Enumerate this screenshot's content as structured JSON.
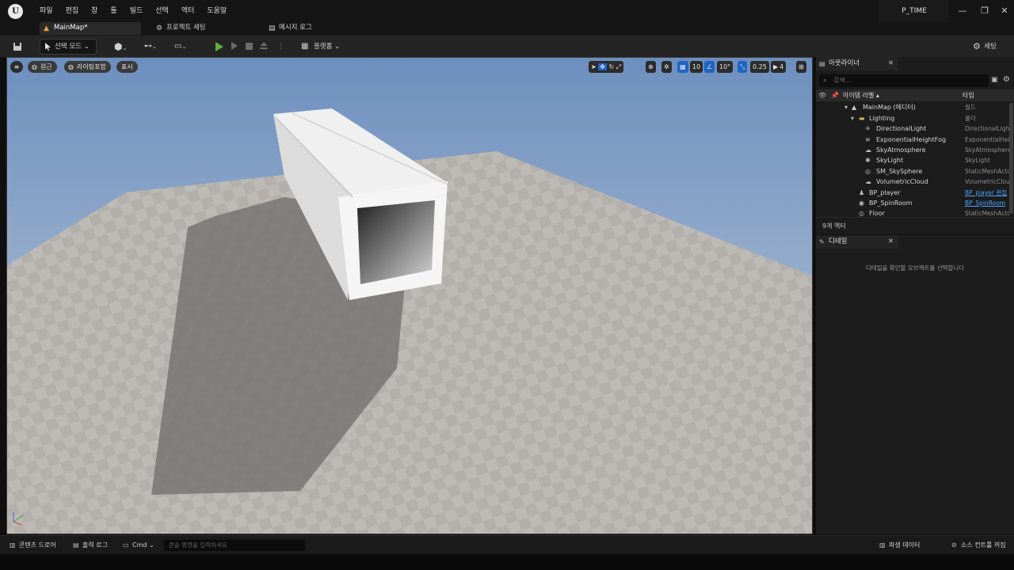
{
  "app": {
    "logo_text": "U",
    "project_name": "P_TIME",
    "window_controls": [
      "—",
      "❐",
      "✕"
    ]
  },
  "menu": [
    "파일",
    "편집",
    "창",
    "툴",
    "빌드",
    "선택",
    "액터",
    "도움말"
  ],
  "tabs": [
    {
      "label": "MainMap*",
      "icon": "level-icon"
    },
    {
      "label": "프로젝트 세팅",
      "icon": "settings-tab-icon"
    },
    {
      "label": "메시지 로그",
      "icon": "log-icon"
    }
  ],
  "toolbar": {
    "select_mode": "선택 모드",
    "platforms": "플랫폼",
    "settings": "세팅"
  },
  "viewport": {
    "perspective": "원근",
    "lit": "라이팅포함",
    "show": "표시",
    "grid_snap": "10",
    "rotation_snap": "10°",
    "scale_snap": "0.25",
    "camera_speed": "4",
    "colors": {
      "sky_top": "#6d8fbe",
      "sky_bottom": "#c6d0dc",
      "floor": "#bdbab5",
      "shadow": "#777672"
    }
  },
  "outliner": {
    "tab_label": "아웃라이너",
    "search_placeholder": "검색...",
    "col_label": "아이템 라벨 ▴",
    "col_type": "타입",
    "rows": [
      {
        "name": "MainMap (에디터)",
        "type": "월드",
        "link": false
      },
      {
        "name": "Lighting",
        "type": "폴더",
        "link": false
      },
      {
        "name": "DirectionalLight",
        "type": "DirectionalLight",
        "link": false
      },
      {
        "name": "ExponentialHeightFog",
        "type": "ExponentialHeightFog",
        "link": false
      },
      {
        "name": "SkyAtmosphere",
        "type": "SkyAtmosphere",
        "link": false
      },
      {
        "name": "SkyLight",
        "type": "SkyLight",
        "link": false
      },
      {
        "name": "SM_SkySphere",
        "type": "StaticMeshActor",
        "link": false
      },
      {
        "name": "VolumetricCloud",
        "type": "VolumetricCloud",
        "link": false
      },
      {
        "name": "BP_player",
        "type": "BP_player 편집",
        "link": true
      },
      {
        "name": "BP_SpinRoom",
        "type": "BP_SpinRoom",
        "link": true
      },
      {
        "name": "Floor",
        "type": "StaticMeshActor",
        "link": false
      }
    ],
    "actor_count": "9개 액터"
  },
  "details": {
    "tab_label": "디테일",
    "empty_message": "디테일을 확인할 오브젝트를 선택합니다"
  },
  "statusbar": {
    "content_drawer": "콘텐츠 드로어",
    "output_log": "출력 로그",
    "cmd": "Cmd",
    "console_placeholder": "콘솔 명령을 입력하세요",
    "derived_data": "파생 데이터",
    "source_control": "소스 컨트롤 꺼짐"
  }
}
